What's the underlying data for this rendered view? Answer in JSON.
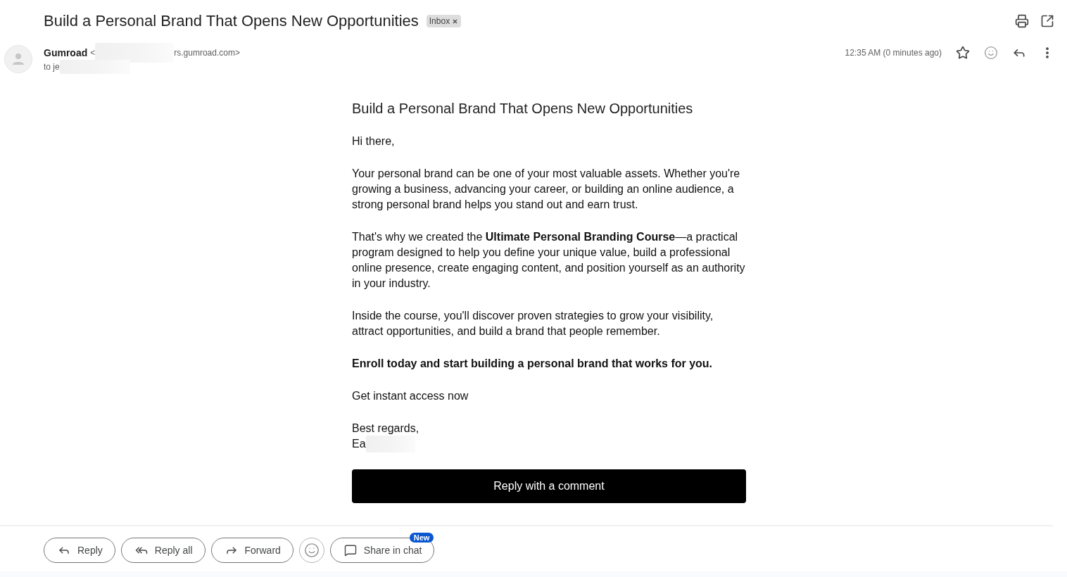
{
  "email": {
    "subject": "Build a Personal Brand That Opens New Opportunities",
    "labels": [
      {
        "text": "Inbox"
      }
    ],
    "sender": {
      "name": "Gumroad",
      "email_start": "<",
      "email_end": "rs.gumroad.com>"
    },
    "recipient": "to je",
    "time": "12:35 AM (0 minutes ago)",
    "starred": false
  },
  "body": {
    "heading": "Build a Personal Brand That Opens New Opportunities",
    "paragraphs": [
      {
        "text": "Hi there,",
        "bold": false
      },
      {
        "text": "Your personal brand can be one of your most valuable assets. Whether you're growing a business, advancing your career, or building an online audience, a strong personal brand helps you stand out and earn trust.",
        "bold": false
      },
      {
        "text": "That's why we created the **Ultimate Personal Branding Course**—a practical program designed to help you define your unique value, build a professional online presence, create engaging content, and position yourself as an authority in your industry.",
        "bold": false
      },
      {
        "text": "Inside the course, you'll discover proven strategies to grow your visibility, attract opportunities, and build a brand that people remember.",
        "bold": false
      },
      {
        "text": "Enroll today and start building a personal brand that works for you.",
        "bold": true
      },
      {
        "text": "Get instant access now",
        "bold": false
      }
    ],
    "signature": {
      "closing": "Best regards,",
      "name": "Ea"
    },
    "cta": "Reply with a comment"
  },
  "actions": [
    {
      "kind": "reply",
      "label": "Reply"
    },
    {
      "kind": "reply_all",
      "label": "Reply all"
    },
    {
      "kind": "forward",
      "label": "Forward"
    },
    {
      "kind": "emoji"
    },
    {
      "kind": "share_chat",
      "label": "Share in chat",
      "badge": "New"
    }
  ]
}
